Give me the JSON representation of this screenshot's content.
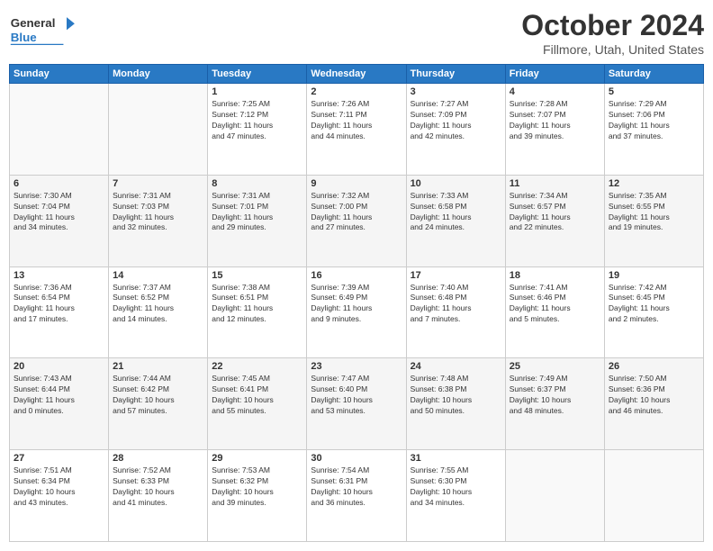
{
  "header": {
    "logo": {
      "line1": "General",
      "line2": "Blue",
      "arrow_color": "#2979c4"
    },
    "title": "October 2024",
    "location": "Fillmore, Utah, United States"
  },
  "days_of_week": [
    "Sunday",
    "Monday",
    "Tuesday",
    "Wednesday",
    "Thursday",
    "Friday",
    "Saturday"
  ],
  "weeks": [
    [
      {
        "day": "",
        "info": ""
      },
      {
        "day": "",
        "info": ""
      },
      {
        "day": "1",
        "info": "Sunrise: 7:25 AM\nSunset: 7:12 PM\nDaylight: 11 hours\nand 47 minutes."
      },
      {
        "day": "2",
        "info": "Sunrise: 7:26 AM\nSunset: 7:11 PM\nDaylight: 11 hours\nand 44 minutes."
      },
      {
        "day": "3",
        "info": "Sunrise: 7:27 AM\nSunset: 7:09 PM\nDaylight: 11 hours\nand 42 minutes."
      },
      {
        "day": "4",
        "info": "Sunrise: 7:28 AM\nSunset: 7:07 PM\nDaylight: 11 hours\nand 39 minutes."
      },
      {
        "day": "5",
        "info": "Sunrise: 7:29 AM\nSunset: 7:06 PM\nDaylight: 11 hours\nand 37 minutes."
      }
    ],
    [
      {
        "day": "6",
        "info": "Sunrise: 7:30 AM\nSunset: 7:04 PM\nDaylight: 11 hours\nand 34 minutes."
      },
      {
        "day": "7",
        "info": "Sunrise: 7:31 AM\nSunset: 7:03 PM\nDaylight: 11 hours\nand 32 minutes."
      },
      {
        "day": "8",
        "info": "Sunrise: 7:31 AM\nSunset: 7:01 PM\nDaylight: 11 hours\nand 29 minutes."
      },
      {
        "day": "9",
        "info": "Sunrise: 7:32 AM\nSunset: 7:00 PM\nDaylight: 11 hours\nand 27 minutes."
      },
      {
        "day": "10",
        "info": "Sunrise: 7:33 AM\nSunset: 6:58 PM\nDaylight: 11 hours\nand 24 minutes."
      },
      {
        "day": "11",
        "info": "Sunrise: 7:34 AM\nSunset: 6:57 PM\nDaylight: 11 hours\nand 22 minutes."
      },
      {
        "day": "12",
        "info": "Sunrise: 7:35 AM\nSunset: 6:55 PM\nDaylight: 11 hours\nand 19 minutes."
      }
    ],
    [
      {
        "day": "13",
        "info": "Sunrise: 7:36 AM\nSunset: 6:54 PM\nDaylight: 11 hours\nand 17 minutes."
      },
      {
        "day": "14",
        "info": "Sunrise: 7:37 AM\nSunset: 6:52 PM\nDaylight: 11 hours\nand 14 minutes."
      },
      {
        "day": "15",
        "info": "Sunrise: 7:38 AM\nSunset: 6:51 PM\nDaylight: 11 hours\nand 12 minutes."
      },
      {
        "day": "16",
        "info": "Sunrise: 7:39 AM\nSunset: 6:49 PM\nDaylight: 11 hours\nand 9 minutes."
      },
      {
        "day": "17",
        "info": "Sunrise: 7:40 AM\nSunset: 6:48 PM\nDaylight: 11 hours\nand 7 minutes."
      },
      {
        "day": "18",
        "info": "Sunrise: 7:41 AM\nSunset: 6:46 PM\nDaylight: 11 hours\nand 5 minutes."
      },
      {
        "day": "19",
        "info": "Sunrise: 7:42 AM\nSunset: 6:45 PM\nDaylight: 11 hours\nand 2 minutes."
      }
    ],
    [
      {
        "day": "20",
        "info": "Sunrise: 7:43 AM\nSunset: 6:44 PM\nDaylight: 11 hours\nand 0 minutes."
      },
      {
        "day": "21",
        "info": "Sunrise: 7:44 AM\nSunset: 6:42 PM\nDaylight: 10 hours\nand 57 minutes."
      },
      {
        "day": "22",
        "info": "Sunrise: 7:45 AM\nSunset: 6:41 PM\nDaylight: 10 hours\nand 55 minutes."
      },
      {
        "day": "23",
        "info": "Sunrise: 7:47 AM\nSunset: 6:40 PM\nDaylight: 10 hours\nand 53 minutes."
      },
      {
        "day": "24",
        "info": "Sunrise: 7:48 AM\nSunset: 6:38 PM\nDaylight: 10 hours\nand 50 minutes."
      },
      {
        "day": "25",
        "info": "Sunrise: 7:49 AM\nSunset: 6:37 PM\nDaylight: 10 hours\nand 48 minutes."
      },
      {
        "day": "26",
        "info": "Sunrise: 7:50 AM\nSunset: 6:36 PM\nDaylight: 10 hours\nand 46 minutes."
      }
    ],
    [
      {
        "day": "27",
        "info": "Sunrise: 7:51 AM\nSunset: 6:34 PM\nDaylight: 10 hours\nand 43 minutes."
      },
      {
        "day": "28",
        "info": "Sunrise: 7:52 AM\nSunset: 6:33 PM\nDaylight: 10 hours\nand 41 minutes."
      },
      {
        "day": "29",
        "info": "Sunrise: 7:53 AM\nSunset: 6:32 PM\nDaylight: 10 hours\nand 39 minutes."
      },
      {
        "day": "30",
        "info": "Sunrise: 7:54 AM\nSunset: 6:31 PM\nDaylight: 10 hours\nand 36 minutes."
      },
      {
        "day": "31",
        "info": "Sunrise: 7:55 AM\nSunset: 6:30 PM\nDaylight: 10 hours\nand 34 minutes."
      },
      {
        "day": "",
        "info": ""
      },
      {
        "day": "",
        "info": ""
      }
    ]
  ]
}
